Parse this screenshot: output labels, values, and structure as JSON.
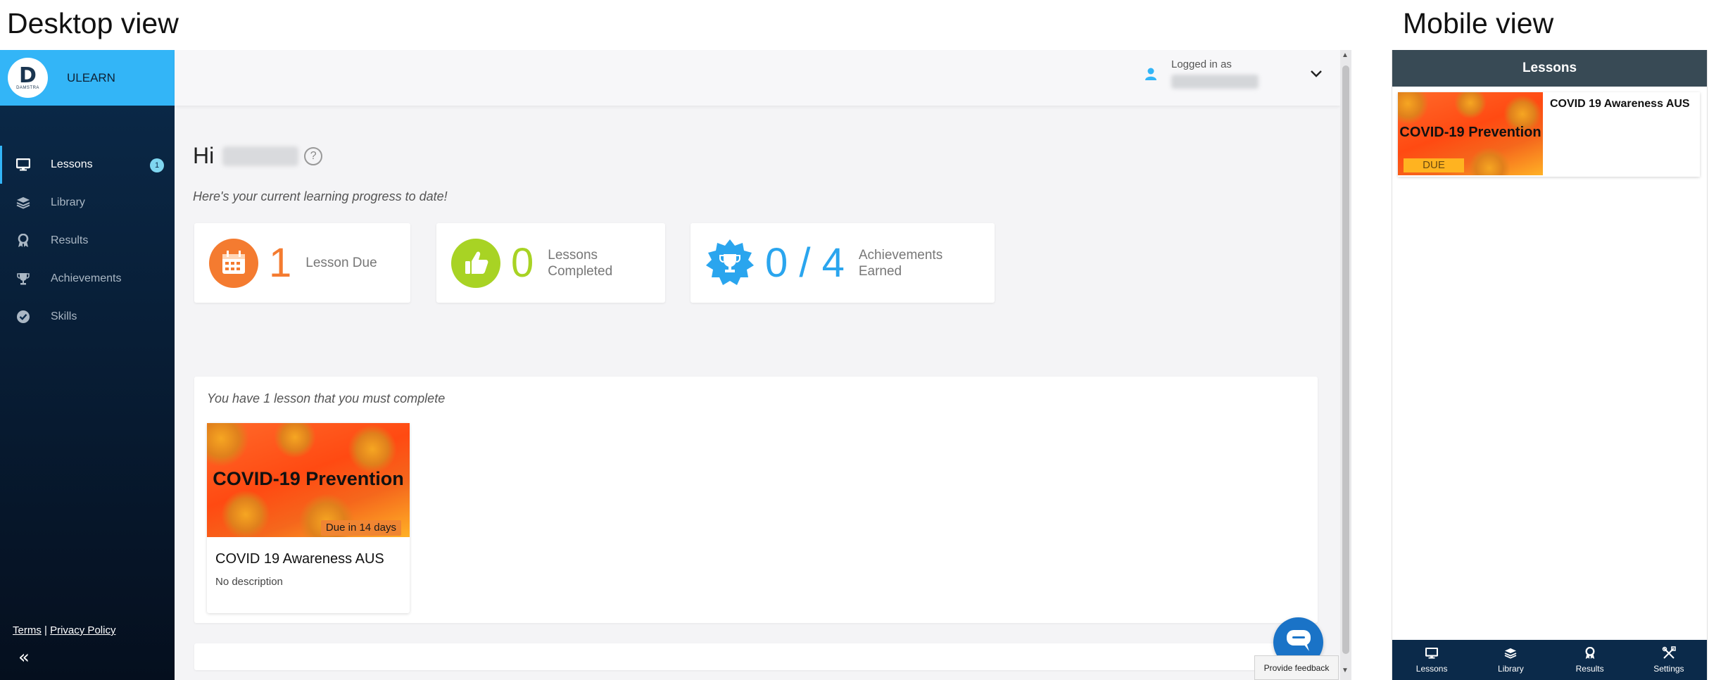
{
  "labels": {
    "desktop": "Desktop view",
    "mobile": "Mobile view"
  },
  "colors": {
    "brand": "#33b5f7",
    "sidebar": "#0b2a4a",
    "due": "#f47b30",
    "completed": "#a8d324",
    "achievements": "#2aa5ee"
  },
  "sidebar": {
    "brand": "ULEARN",
    "logo_sub": "DAMSTRA",
    "items": [
      {
        "label": "Lessons",
        "icon": "monitor-icon",
        "badge": "1",
        "active": true
      },
      {
        "label": "Library",
        "icon": "layers-icon"
      },
      {
        "label": "Results",
        "icon": "ribbon-icon"
      },
      {
        "label": "Achievements",
        "icon": "trophy-icon"
      },
      {
        "label": "Skills",
        "icon": "check-circle-icon"
      }
    ],
    "footer": {
      "terms": "Terms",
      "sep": "|",
      "privacy": "Privacy Policy",
      "collapse": "«"
    }
  },
  "topbar": {
    "logged_in_label": "Logged in as"
  },
  "main": {
    "greeting": "Hi",
    "help": "?",
    "subtitle": "Here's your current learning progress to date!",
    "stats": {
      "due": {
        "value": "1",
        "label": "Lesson Due"
      },
      "completed": {
        "value": "0",
        "label_line1": "Lessons",
        "label_line2": "Completed"
      },
      "achievements": {
        "value": "0 / 4",
        "label_line1": "Achievements",
        "label_line2": "Earned"
      }
    },
    "panel_message": "You have 1 lesson that you must complete",
    "lesson": {
      "thumb_title": "COVID-19 Prevention",
      "due_tag": "Due in 14 days",
      "title": "COVID 19 Awareness AUS",
      "description": "No description"
    }
  },
  "feedback": "Provide feedback",
  "mobile": {
    "header": "Lessons",
    "lesson": {
      "thumb_title": "COVID-19 Prevention",
      "due": "DUE",
      "title": "COVID 19 Awareness AUS"
    },
    "nav": [
      {
        "label": "Lessons",
        "icon": "monitor-icon"
      },
      {
        "label": "Library",
        "icon": "layers-icon"
      },
      {
        "label": "Results",
        "icon": "ribbon-icon"
      },
      {
        "label": "Settings",
        "icon": "tools-icon"
      }
    ]
  }
}
